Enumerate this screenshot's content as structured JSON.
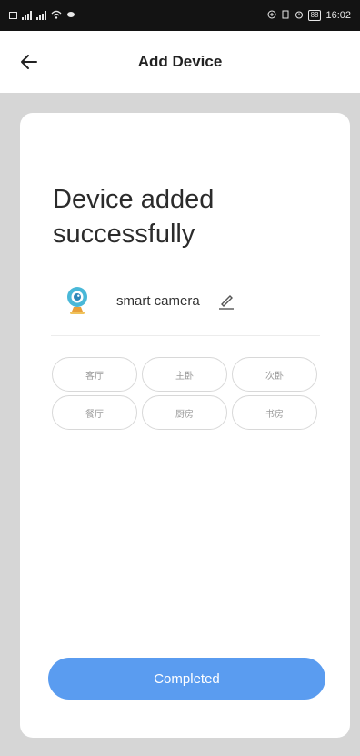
{
  "status_bar": {
    "time": "16:02",
    "battery": "88",
    "icons": [
      "sim-icon",
      "signal-icon",
      "signal-icon",
      "wifi-icon",
      "notification-icon",
      "nfc-icon",
      "vibrate-icon",
      "alarm-icon",
      "battery-icon"
    ]
  },
  "header": {
    "back_icon": "back-arrow-icon",
    "title": "Add Device"
  },
  "main": {
    "headline": "Device added successfully",
    "device": {
      "icon": "camera-icon",
      "name": "smart camera",
      "edit_icon": "pencil-icon"
    },
    "rooms": [
      "客厅",
      "主卧",
      "次卧",
      "餐厅",
      "厨房",
      "书房"
    ],
    "complete_button": "Completed"
  },
  "colors": {
    "accent": "#5a9cf0",
    "background": "#d6d6d6",
    "card": "#ffffff",
    "camera_icon": "#49b8d8"
  }
}
